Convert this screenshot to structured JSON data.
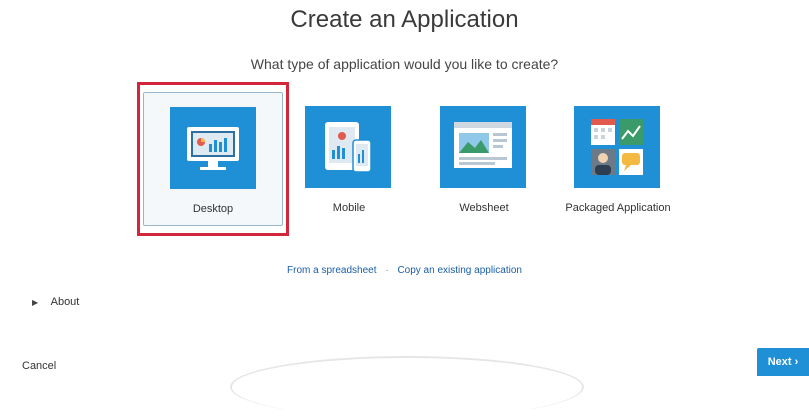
{
  "header": {
    "title": "Create an Application",
    "subtitle": "What type of application would you like to create?"
  },
  "app_types": [
    {
      "label": "Desktop",
      "icon": "desktop-monitor-icon",
      "selected": true
    },
    {
      "label": "Mobile",
      "icon": "mobile-devices-icon",
      "selected": false
    },
    {
      "label": "Websheet",
      "icon": "websheet-icon",
      "selected": false
    },
    {
      "label": "Packaged Application",
      "icon": "packaged-application-icon",
      "selected": false
    }
  ],
  "links": {
    "from_spreadsheet": "From a spreadsheet",
    "separator": "·",
    "copy_existing": "Copy an existing application"
  },
  "about": {
    "label": "About",
    "icon": "expand-triangle-icon"
  },
  "footer": {
    "cancel_label": "Cancel",
    "next_label": "Next",
    "next_icon": "chevron-right-icon"
  },
  "colors": {
    "accent": "#1f8fd6",
    "selection_highlight": "#d4263a",
    "link": "#1a5ea8"
  }
}
